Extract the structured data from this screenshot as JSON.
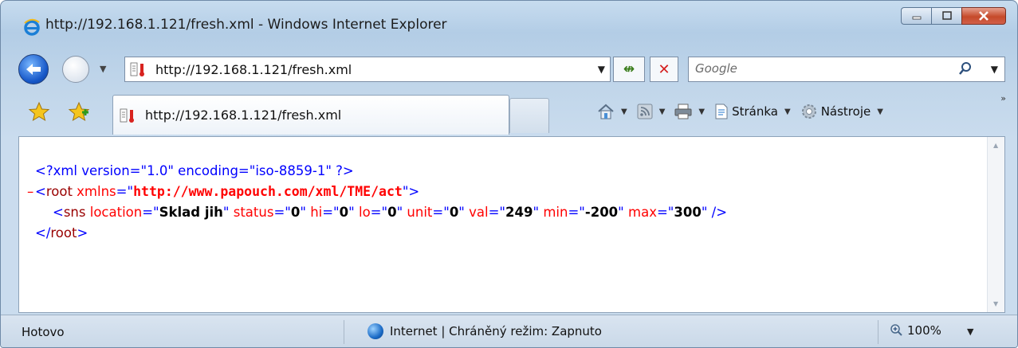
{
  "window": {
    "title": "http://192.168.1.121/fresh.xml - Windows Internet Explorer"
  },
  "address_bar": {
    "url": "http://192.168.1.121/fresh.xml"
  },
  "search": {
    "placeholder": "Google"
  },
  "tab": {
    "title": "http://192.168.1.121/fresh.xml"
  },
  "command_bar": {
    "page_label": "Stránka",
    "tools_label": "Nástroje"
  },
  "xml": {
    "line1": {
      "open": "<?xml version=\"1.0\" encoding=\"iso-8859-1\" ?>"
    },
    "line2": {
      "collapse": "–",
      "tag_open": "<",
      "tag": "root",
      "attr": "xmlns",
      "eq": "=\"",
      "value": "http://www.papouch.com/xml/TME/act",
      "close": "\">"
    },
    "line3": {
      "tag_open": "<",
      "tag": "sns",
      "attrs": [
        {
          "name": "location",
          "value": "Sklad jih"
        },
        {
          "name": "status",
          "value": "0"
        },
        {
          "name": "hi",
          "value": "0"
        },
        {
          "name": "lo",
          "value": "0"
        },
        {
          "name": "unit",
          "value": "0"
        },
        {
          "name": "val",
          "value": "249"
        },
        {
          "name": "min",
          "value": "-200"
        },
        {
          "name": "max",
          "value": "300"
        }
      ],
      "close": "\" />"
    },
    "line4": {
      "tag_open": "</",
      "tag": "root",
      "close": ">"
    }
  },
  "status_bar": {
    "status": "Hotovo",
    "zone": "Internet | Chráněný režim: Zapnuto",
    "zoom": "100%"
  },
  "colors": {
    "xml_markup": "#0000ff",
    "xml_tag": "#990000",
    "xml_attr": "#ff0000",
    "close_button": "#c54a2a"
  }
}
